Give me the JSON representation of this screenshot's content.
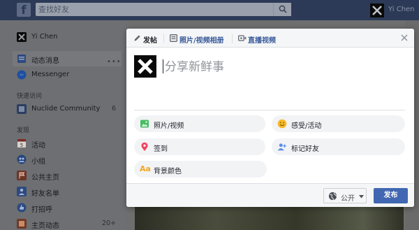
{
  "topbar": {
    "logo": "f",
    "search_placeholder": "查找好友",
    "user_name": "Yi Chen"
  },
  "sidebar": {
    "profile_name": "Yi Chen",
    "items_main": [
      {
        "label": "动态消息",
        "icon": "news-feed-icon"
      },
      {
        "label": "Messenger",
        "icon": "messenger-icon"
      }
    ],
    "section_shortcuts": "快速访问",
    "shortcuts": [
      {
        "label": "Nuclide Community",
        "count": "6",
        "icon": "group-icon"
      }
    ],
    "section_explore": "发现",
    "explore": [
      {
        "label": "活动",
        "icon": "calendar-icon",
        "calendar_day": "5"
      },
      {
        "label": "小组",
        "icon": "groups-icon"
      },
      {
        "label": "公共主页",
        "icon": "flag-icon"
      },
      {
        "label": "好友名单",
        "icon": "friend-list-icon"
      },
      {
        "label": "打招呼",
        "icon": "poke-icon"
      },
      {
        "label": "主页动态",
        "count": "20+",
        "icon": "page-feed-icon"
      }
    ],
    "more_dots": "•••"
  },
  "composer": {
    "tabs": [
      {
        "label": "发帖",
        "icon": "pencil-icon"
      },
      {
        "label": "照片/视频相册",
        "icon": "photo-album-icon"
      },
      {
        "label": "直播视频",
        "icon": "live-video-icon"
      }
    ],
    "placeholder": "分享新鲜事",
    "options": [
      {
        "label": "照片/视频",
        "icon": "photo-icon"
      },
      {
        "label": "感受/活动",
        "icon": "smiley-icon"
      },
      {
        "label": "签到",
        "icon": "location-pin-icon"
      },
      {
        "label": "标记好友",
        "icon": "tag-friends-icon"
      },
      {
        "label": "背景颜色",
        "icon": "text-aa-icon",
        "glyph": "Aa"
      }
    ],
    "privacy_label": "公开",
    "post_label": "发布"
  },
  "colors": {
    "brand_blue": "#4267b2",
    "link_blue": "#365899",
    "topbar": "#2c3a57"
  }
}
